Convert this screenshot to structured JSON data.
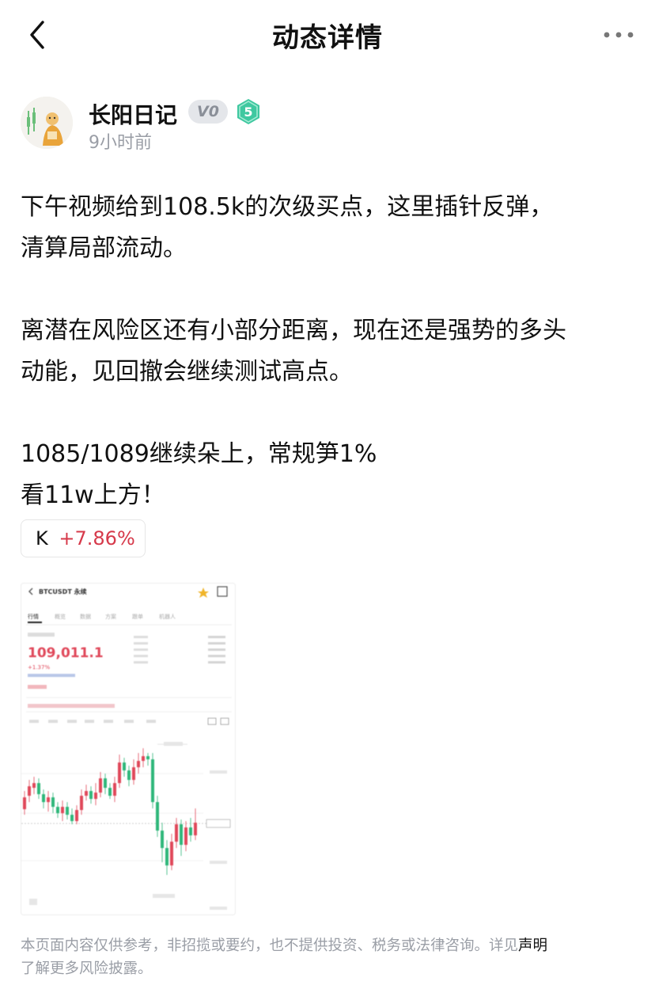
{
  "nav": {
    "title": "动态详情",
    "back_icon": "chevron-left-icon",
    "more_icon": "more-horizontal-icon"
  },
  "author": {
    "name": "长阳日记",
    "vip_badge": "V0",
    "level_badge": "5",
    "time": "9小时前"
  },
  "post": {
    "paragraphs": [
      "下午视频给到108.5k的次级买点，这里插针反弹，\n清算局部流动。",
      "离潜在风险区还有小部分距离，现在还是强势的多头\n动能，见回撤会继续测试高点。",
      "1085/1089继续朵上，常规笋1%\n看11w上方！"
    ]
  },
  "ticker_tag": {
    "symbol": "K",
    "change": "+7.86%"
  },
  "screenshot": {
    "pair": "BTCUSDT 永续",
    "tabs": [
      "行情",
      "概览",
      "数据",
      "方案",
      "跟单",
      "机器人"
    ],
    "price": "109,011.1",
    "change": "+1.37%",
    "colors": {
      "up": "#e0485a",
      "down": "#2fb77a"
    }
  },
  "footer": {
    "text": "本页面内容仅供参考，非招揽或要约，也不提供投资、税务或法律咨询。详见",
    "link": "声明",
    "text2": "了解更多风险披露。"
  },
  "colors": {
    "accent_red": "#d6394a",
    "muted": "#9a9ea6",
    "level_badge": "#3fc8a0"
  }
}
